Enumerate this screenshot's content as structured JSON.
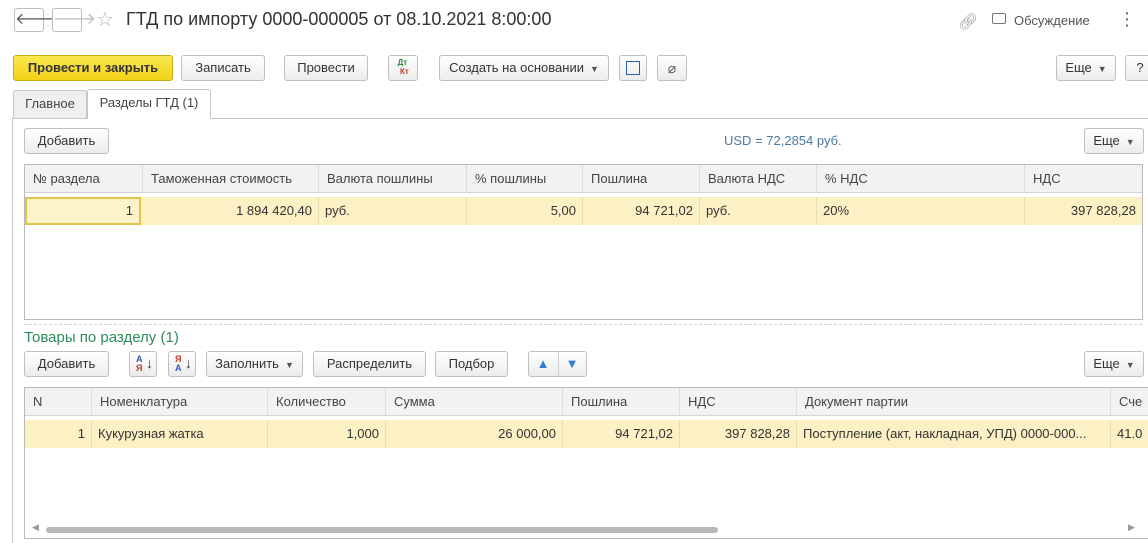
{
  "window": {
    "title": "ГТД по импорту 0000-000005 от 08.10.2021 8:00:00",
    "back": "🡐",
    "forward": "🡒",
    "discuss": "Обсуждение"
  },
  "toolbar": {
    "post_close": "Провести и закрыть",
    "save": "Записать",
    "post": "Провести",
    "dtkt_dt": "Дт",
    "dtkt_kt": "Кт",
    "create_based": "Создать на основании",
    "more": "Еще",
    "help": "?"
  },
  "tabs": [
    {
      "label": "Главное",
      "active": false
    },
    {
      "label": "Разделы ГТД (1)",
      "active": true
    }
  ],
  "sections": {
    "add": "Добавить",
    "rate": "USD = 72,2854 руб.",
    "more": "Еще",
    "columns": [
      "№ раздела",
      "Таможенная стоимость",
      "Валюта пошлины",
      "% пошлины",
      "Пошлина",
      "Валюта НДС",
      "% НДС",
      "НДС"
    ],
    "rows": [
      [
        "1",
        "1 894 420,40",
        "руб.",
        "5,00",
        "94 721,02",
        "руб.",
        "20%",
        "397 828,28"
      ]
    ]
  },
  "goods": {
    "title": "Товары по разделу (1)",
    "add": "Добавить",
    "sort_a": "А",
    "sort_z": "Я",
    "fill": "Заполнить",
    "distribute": "Распределить",
    "pick": "Подбор",
    "more": "Еще",
    "columns": [
      "N",
      "Номенклатура",
      "Количество",
      "Сумма",
      "Пошлина",
      "НДС",
      "Документ партии",
      "Сче"
    ],
    "rows": [
      [
        "1",
        "Кукурузная жатка",
        "1,000",
        "26 000,00",
        "94 721,02",
        "397 828,28",
        "Поступление (акт, накладная, УПД) 0000-000...",
        "41.0"
      ]
    ]
  },
  "colors": {
    "primary_button": "#f3d219",
    "selected_row": "#fbf1c4",
    "section_title": "#2e8b57",
    "rate_text": "#4a7aa0"
  }
}
